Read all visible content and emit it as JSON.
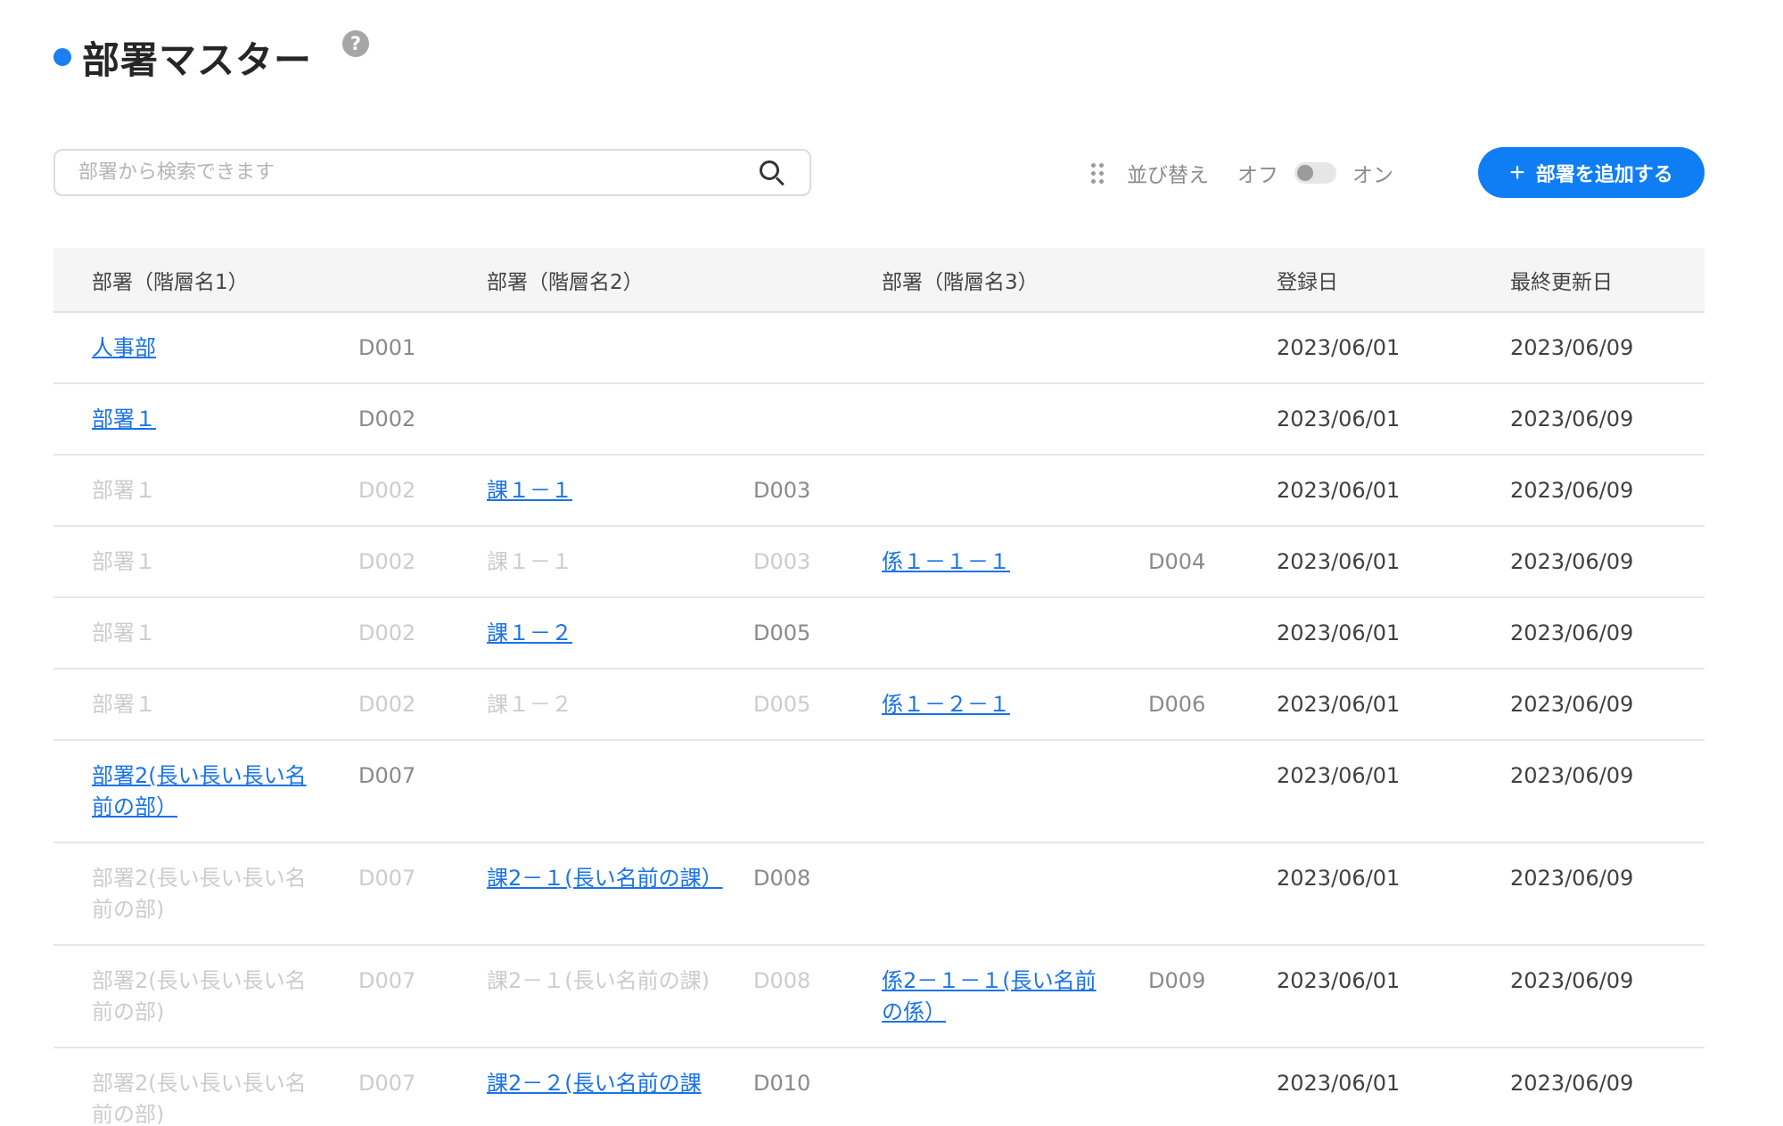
{
  "header": {
    "title": "部署マスター",
    "help_icon": "?"
  },
  "search": {
    "placeholder": "部署から検索できます",
    "value": ""
  },
  "sort": {
    "label": "並び替え",
    "off_label": "オフ",
    "on_label": "オン",
    "enabled": false
  },
  "add_button": {
    "icon": "+",
    "label": "部署を追加する"
  },
  "colors": {
    "accent": "#0f7ef5",
    "link": "#1a73e8",
    "faded_text": "#cccccc"
  },
  "table": {
    "columns": [
      "部署（階層名1）",
      "部署（階層名2）",
      "部署（階層名3）",
      "登録日",
      "最終更新日"
    ],
    "rows": [
      {
        "name1": "人事部",
        "code1": "D001",
        "name2": "",
        "code2": "",
        "name3": "",
        "code3": "",
        "registered": "2023/06/01",
        "updated": "2023/06/09",
        "active_level": 1
      },
      {
        "name1": "部署１",
        "code1": "D002",
        "name2": "",
        "code2": "",
        "name3": "",
        "code3": "",
        "registered": "2023/06/01",
        "updated": "2023/06/09",
        "active_level": 1
      },
      {
        "name1": "部署１",
        "code1": "D002",
        "name2": "課１－１",
        "code2": "D003",
        "name3": "",
        "code3": "",
        "registered": "2023/06/01",
        "updated": "2023/06/09",
        "active_level": 2
      },
      {
        "name1": "部署１",
        "code1": "D002",
        "name2": "課１－１",
        "code2": "D003",
        "name3": "係１－１－１",
        "code3": "D004",
        "registered": "2023/06/01",
        "updated": "2023/06/09",
        "active_level": 3
      },
      {
        "name1": "部署１",
        "code1": "D002",
        "name2": "課１－２",
        "code2": "D005",
        "name3": "",
        "code3": "",
        "registered": "2023/06/01",
        "updated": "2023/06/09",
        "active_level": 2
      },
      {
        "name1": "部署１",
        "code1": "D002",
        "name2": "課１－２",
        "code2": "D005",
        "name3": "係１－２－１",
        "code3": "D006",
        "registered": "2023/06/01",
        "updated": "2023/06/09",
        "active_level": 3
      },
      {
        "name1": "部署2(長い長い長い名前の部）",
        "code1": "D007",
        "name2": "",
        "code2": "",
        "name3": "",
        "code3": "",
        "registered": "2023/06/01",
        "updated": "2023/06/09",
        "active_level": 1
      },
      {
        "name1": "部署2(長い長い長い名前の部)",
        "code1": "D007",
        "name2": "課2－１(長い名前の課）",
        "code2": "D008",
        "name3": "",
        "code3": "",
        "registered": "2023/06/01",
        "updated": "2023/06/09",
        "active_level": 2
      },
      {
        "name1": "部署2(長い長い長い名前の部)",
        "code1": "D007",
        "name2": "課2－１(長い名前の課)",
        "code2": "D008",
        "name3": "係2－１－１(長い名前の係）",
        "code3": "D009",
        "registered": "2023/06/01",
        "updated": "2023/06/09",
        "active_level": 3
      },
      {
        "name1": "部署2(長い長い長い名前の部)",
        "code1": "D007",
        "name2": "課2－２(長い名前の課",
        "code2": "D010",
        "name3": "",
        "code3": "",
        "registered": "2023/06/01",
        "updated": "2023/06/09",
        "active_level": 2
      }
    ]
  }
}
